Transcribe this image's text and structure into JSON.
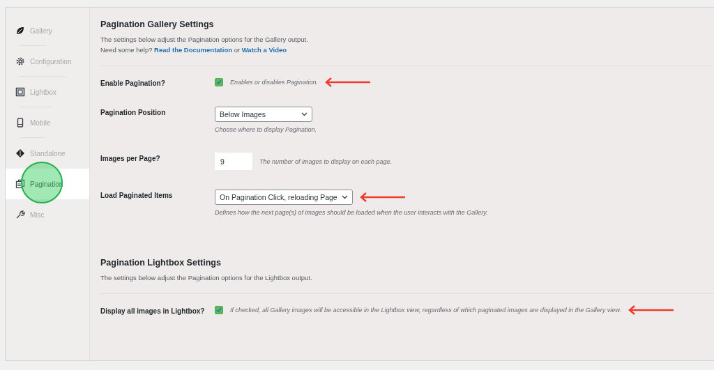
{
  "sidebar": {
    "items": [
      {
        "label": "Gallery",
        "selected": false,
        "circled": false
      },
      {
        "label": "Configuration",
        "selected": false,
        "circled": false
      },
      {
        "label": "Lightbox",
        "selected": false,
        "circled": false
      },
      {
        "label": "Mobile",
        "selected": false,
        "circled": false
      },
      {
        "label": "Standalone",
        "selected": false,
        "circled": false
      },
      {
        "label": "Pagination",
        "selected": true,
        "circled": true
      },
      {
        "label": "Misc",
        "selected": false,
        "circled": false
      }
    ]
  },
  "sections": [
    {
      "title": "Pagination Gallery Settings",
      "description": "The settings below adjust the Pagination options for the Gallery output.",
      "help": {
        "text": "Need some help?",
        "links": [
          "Read the Documentation",
          "Watch a Video"
        ],
        "joiner": "or"
      },
      "rows": [
        {
          "kind": "checkbox",
          "label": "Enable Pagination?",
          "checked": true,
          "hint": "Enables or disables Pagination.",
          "arrow": true
        },
        {
          "kind": "select",
          "label": "Pagination Position",
          "value": "Below Images",
          "hint": "Choose where to display Pagination.",
          "arrow": false
        },
        {
          "kind": "number",
          "label": "Images per Page?",
          "value": "9",
          "hint": "The number of images to display on each page.",
          "arrow": false
        },
        {
          "kind": "select",
          "label": "Load Paginated Items",
          "value": "On Pagination Click, reloading Page",
          "hint": "Defines how the next page(s) of images should be loaded when the user interacts with the Gallery.",
          "arrow": true
        }
      ]
    },
    {
      "title": "Pagination Lightbox Settings",
      "description": "The settings below adjust the Pagination options for the Lightbox output.",
      "rows": [
        {
          "kind": "checkbox",
          "label": "Display all images in Lightbox?",
          "checked": true,
          "hint": "If checked, all Gallery images will be accessible in the Lightbox view, regardless of which paginated images are displayed in the Gallery view.",
          "arrow": true
        }
      ]
    }
  ]
}
